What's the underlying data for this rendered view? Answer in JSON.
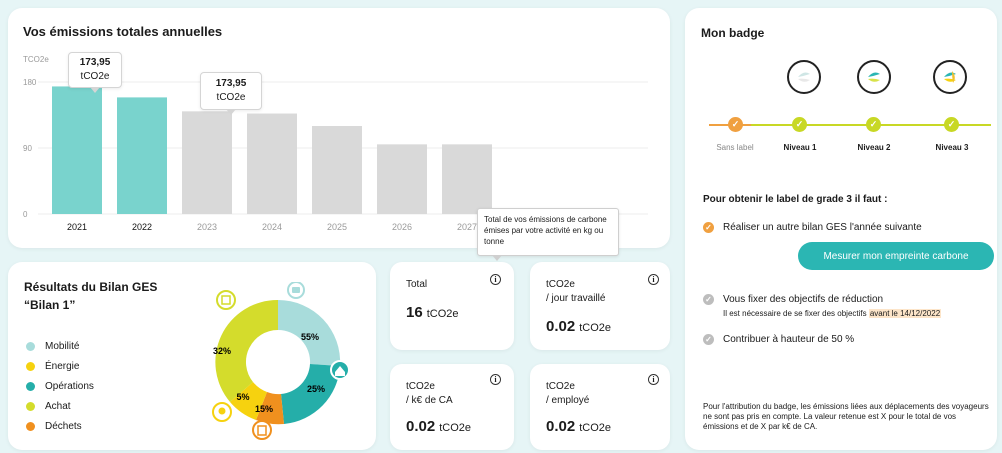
{
  "emissions": {
    "title": "Vos émissions totales annuelles",
    "unit_label": "TCO2e",
    "tooltip_2021": {
      "value": "173,95",
      "unit": "tCO2e"
    },
    "tooltip_2023": {
      "value": "173,95",
      "unit": "tCO2e"
    },
    "chart_data": {
      "type": "bar",
      "title": "Vos émissions totales annuelles",
      "ylabel": "TCO2e",
      "ylim": [
        0,
        180
      ],
      "yticks": [
        "0",
        "90",
        "180"
      ],
      "categories": [
        "2021",
        "2022",
        "2023",
        "2024",
        "2025",
        "2026",
        "2027"
      ],
      "values": [
        173.95,
        159,
        140,
        137,
        120,
        95,
        95
      ],
      "colors": [
        "#79d3cd",
        "#79d3cd",
        "#d9d9d9",
        "#d9d9d9",
        "#d9d9d9",
        "#d9d9d9",
        "#d9d9d9"
      ],
      "grid": true
    }
  },
  "info_tooltip": "Total de vos émissions de carbone émises par votre activité en kg ou tonne",
  "results": {
    "title_line1": "Résultats du Bilan GES",
    "title_line2": "“Bilan 1”",
    "legend": [
      {
        "label": "Mobilité",
        "color": "#a8dcdb"
      },
      {
        "label": "Énergie",
        "color": "#f6d20f"
      },
      {
        "label": "Opérations",
        "color": "#25aea9"
      },
      {
        "label": "Achat",
        "color": "#d4dc2c"
      },
      {
        "label": "Déchets",
        "color": "#f0901e"
      }
    ],
    "donut": {
      "slices": [
        {
          "label": "Mobilité",
          "percent": 55,
          "color": "#a8dcdb",
          "text": "55%"
        },
        {
          "label": "Opérations",
          "percent": 25,
          "color": "#25aea9",
          "text": "25%"
        },
        {
          "label": "Déchets",
          "percent": 15,
          "color": "#f0901e",
          "text": "15%"
        },
        {
          "label": "Énergie",
          "percent": 5,
          "color": "#f6d20f",
          "text": "5%"
        },
        {
          "label": "Achat",
          "percent": 32,
          "color": "#d4dc2c",
          "text": "32%"
        }
      ]
    }
  },
  "metrics": {
    "total": {
      "label1": "Total",
      "label2": "",
      "value": "16",
      "unit": "tCO2e"
    },
    "jour": {
      "label1": "tCO2e",
      "label2": "/ jour travaillé",
      "value": "0.02",
      "unit": "tCO2e"
    },
    "ca": {
      "label1": "tCO2e",
      "label2": "/ k€ de CA",
      "value": "0.02",
      "unit": "tCO2e"
    },
    "employe": {
      "label1": "tCO2e",
      "label2": "/ employé",
      "value": "0.02",
      "unit": "tCO2e"
    }
  },
  "badge": {
    "title": "Mon badge",
    "levels": [
      "Sans label",
      "Niveau 1",
      "Niveau 2",
      "Niveau 3"
    ],
    "requirements_title": "Pour obtenir le label de grade 3 il faut :",
    "req1": "Réaliser un autre bilan GES l'année suivante",
    "measure_button": "Mesurer mon empreinte carbone",
    "req2": "Vous fixer des objectifs de réduction",
    "req2_note": "Il est nécessaire de se fixer des objectifs ",
    "req2_deadline": "avant le 14/12/2022",
    "req3": "Contribuer à hauteur de 50 %",
    "note": "Pour l'attribution du badge, les émissions liées aux déplacements des voyageurs ne sont pas pris en compte. La valeur retenue est X pour le total de vos émissions et de X par k€ de CA.",
    "colors": {
      "accent": "#2bb6b3",
      "lime": "#c8d825",
      "orange": "#f0a040",
      "grey": "#bdbdbd"
    }
  }
}
